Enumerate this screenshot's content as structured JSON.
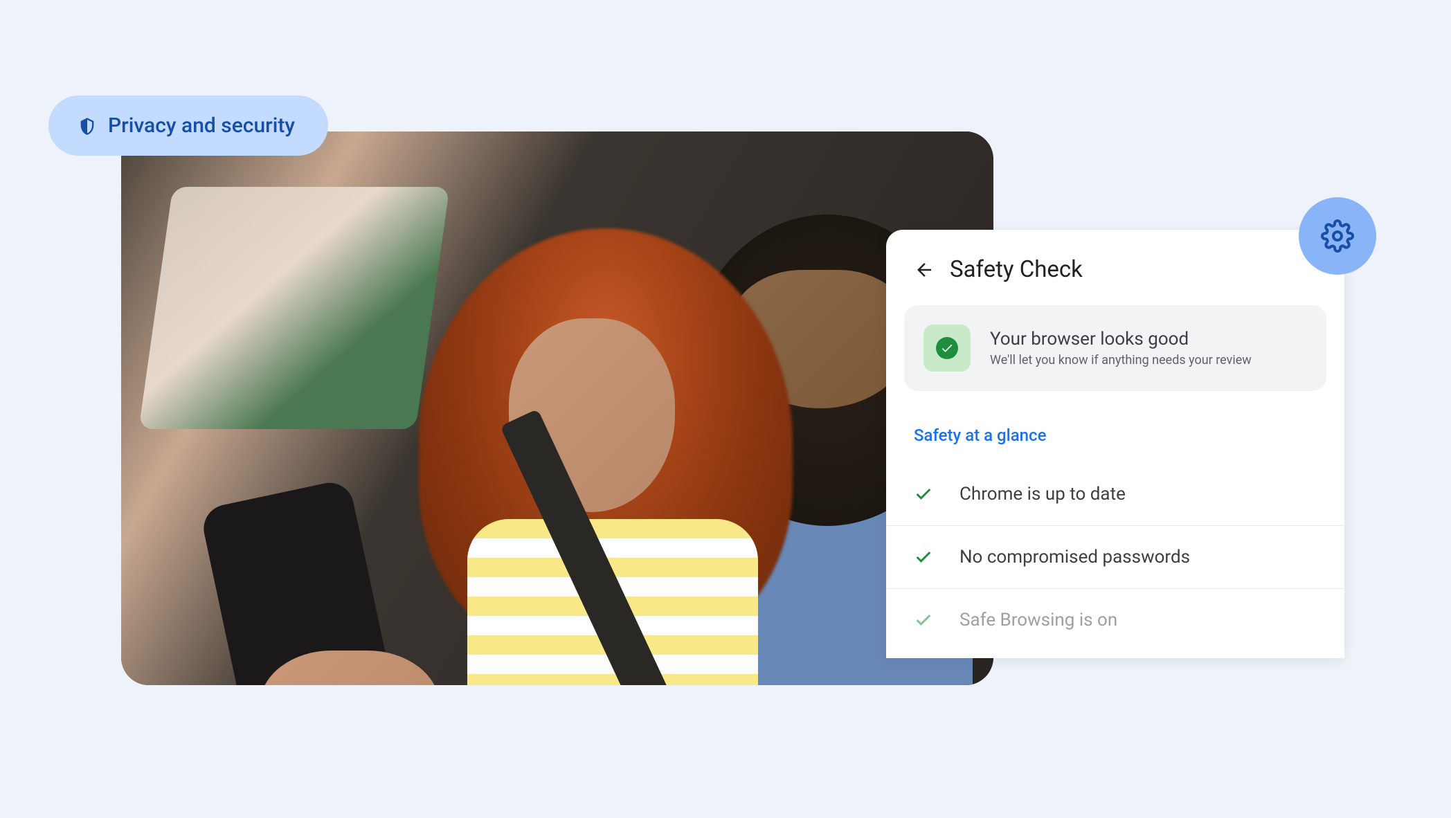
{
  "chip": {
    "label": "Privacy and security"
  },
  "safety_check": {
    "title": "Safety Check",
    "status": {
      "title": "Your browser looks good",
      "subtitle": "We'll let you know if anything needs your review"
    },
    "section_label": "Safety at a glance",
    "items": [
      {
        "label": "Chrome is up to date",
        "faded": false
      },
      {
        "label": "No compromised passwords",
        "faded": false
      },
      {
        "label": "Safe Browsing is on",
        "faded": true
      }
    ]
  }
}
